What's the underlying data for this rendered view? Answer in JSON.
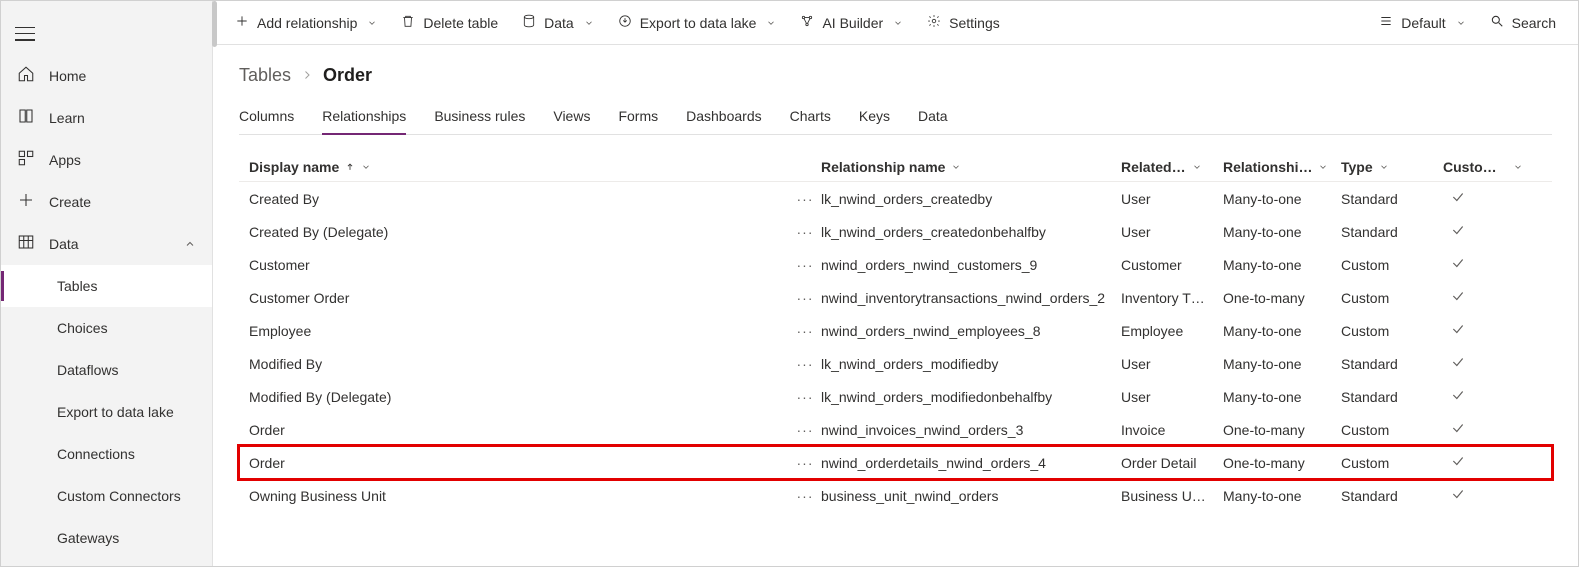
{
  "sidebar": {
    "items": [
      {
        "label": "Home",
        "icon": "home-icon"
      },
      {
        "label": "Learn",
        "icon": "learn-icon"
      },
      {
        "label": "Apps",
        "icon": "apps-icon"
      },
      {
        "label": "Create",
        "icon": "plus-icon"
      },
      {
        "label": "Data",
        "icon": "data-icon",
        "expanded": true,
        "children": [
          {
            "label": "Tables",
            "selected": true
          },
          {
            "label": "Choices"
          },
          {
            "label": "Dataflows"
          },
          {
            "label": "Export to data lake"
          },
          {
            "label": "Connections"
          },
          {
            "label": "Custom Connectors"
          },
          {
            "label": "Gateways"
          }
        ]
      }
    ]
  },
  "commandBar": {
    "addRelationship": "Add relationship",
    "deleteTable": "Delete table",
    "data": "Data",
    "exportToDataLake": "Export to data lake",
    "aiBuilder": "AI Builder",
    "settings": "Settings",
    "default": "Default",
    "searchPlaceholder": "Search"
  },
  "breadcrumb": {
    "root": "Tables",
    "leaf": "Order"
  },
  "tabs": [
    "Columns",
    "Relationships",
    "Business rules",
    "Views",
    "Forms",
    "Dashboards",
    "Charts",
    "Keys",
    "Data"
  ],
  "activeTabIndex": 1,
  "grid": {
    "headers": {
      "displayName": "Display name",
      "relationshipName": "Relationship name",
      "related": "Related…",
      "relationshipType": "Relationshi…",
      "type": "Type",
      "custom": "Custom…"
    },
    "rows": [
      {
        "displayName": "Created By",
        "relationshipName": "lk_nwind_orders_createdby",
        "related": "User",
        "relType": "Many-to-one",
        "type": "Standard",
        "custom": true
      },
      {
        "displayName": "Created By (Delegate)",
        "relationshipName": "lk_nwind_orders_createdonbehalfby",
        "related": "User",
        "relType": "Many-to-one",
        "type": "Standard",
        "custom": true
      },
      {
        "displayName": "Customer",
        "relationshipName": "nwind_orders_nwind_customers_9",
        "related": "Customer",
        "relType": "Many-to-one",
        "type": "Custom",
        "custom": true
      },
      {
        "displayName": "Customer Order",
        "relationshipName": "nwind_inventorytransactions_nwind_orders_2",
        "related": "Inventory T…",
        "relType": "One-to-many",
        "type": "Custom",
        "custom": true
      },
      {
        "displayName": "Employee",
        "relationshipName": "nwind_orders_nwind_employees_8",
        "related": "Employee",
        "relType": "Many-to-one",
        "type": "Custom",
        "custom": true
      },
      {
        "displayName": "Modified By",
        "relationshipName": "lk_nwind_orders_modifiedby",
        "related": "User",
        "relType": "Many-to-one",
        "type": "Standard",
        "custom": true
      },
      {
        "displayName": "Modified By (Delegate)",
        "relationshipName": "lk_nwind_orders_modifiedonbehalfby",
        "related": "User",
        "relType": "Many-to-one",
        "type": "Standard",
        "custom": true
      },
      {
        "displayName": "Order",
        "relationshipName": "nwind_invoices_nwind_orders_3",
        "related": "Invoice",
        "relType": "One-to-many",
        "type": "Custom",
        "custom": true
      },
      {
        "displayName": "Order",
        "relationshipName": "nwind_orderdetails_nwind_orders_4",
        "related": "Order Detail",
        "relType": "One-to-many",
        "type": "Custom",
        "custom": true,
        "highlight": true
      },
      {
        "displayName": "Owning Business Unit",
        "relationshipName": "business_unit_nwind_orders",
        "related": "Business U…",
        "relType": "Many-to-one",
        "type": "Standard",
        "custom": true
      }
    ]
  }
}
